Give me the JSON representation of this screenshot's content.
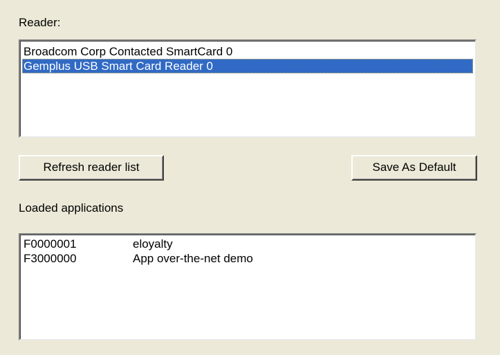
{
  "reader": {
    "label": "Reader:",
    "items": [
      {
        "label": "Broadcom Corp Contacted SmartCard 0",
        "selected": false
      },
      {
        "label": "Gemplus USB Smart Card Reader 0",
        "selected": true
      }
    ],
    "selection_color": "#316ac5"
  },
  "buttons": {
    "refresh_label": "Refresh reader list",
    "save_default_label": "Save As Default"
  },
  "applications": {
    "label": "Loaded applications",
    "rows": [
      {
        "aid": "F0000001",
        "name": "eloyalty"
      },
      {
        "aid": "F3000000",
        "name": "App over-the-net demo"
      }
    ]
  },
  "colors": {
    "window_background": "#ece9d8",
    "list_background": "#ffffff"
  }
}
